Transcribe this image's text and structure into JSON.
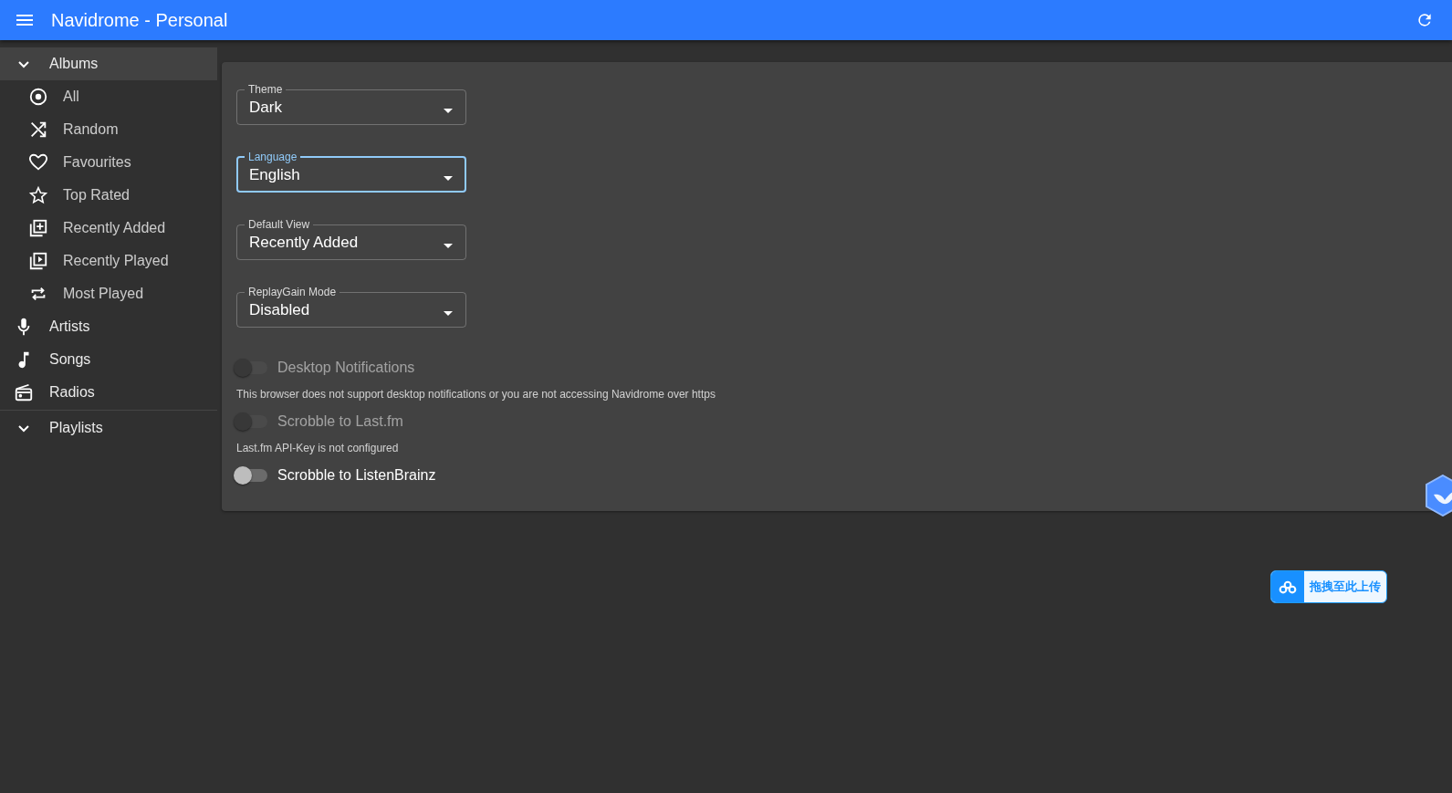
{
  "app_bar": {
    "title": "Navidrome - Personal"
  },
  "sidebar": {
    "items": [
      {
        "label": "Albums",
        "kind": "group",
        "expanded": true,
        "selected": true,
        "children": [
          {
            "label": "All",
            "selected": false
          },
          {
            "label": "Random",
            "selected": false
          },
          {
            "label": "Favourites",
            "selected": false
          },
          {
            "label": "Top Rated",
            "selected": false
          },
          {
            "label": "Recently Added",
            "selected": false
          },
          {
            "label": "Recently Played",
            "selected": false
          },
          {
            "label": "Most Played",
            "selected": false
          }
        ]
      },
      {
        "label": "Artists",
        "kind": "link",
        "selected": false
      },
      {
        "label": "Songs",
        "kind": "link",
        "selected": false
      },
      {
        "label": "Radios",
        "kind": "link",
        "selected": false
      },
      {
        "label": "Playlists",
        "kind": "group",
        "expanded": true,
        "selected": false
      }
    ]
  },
  "settings": {
    "selects": [
      {
        "label": "Theme",
        "value": "Dark",
        "focused": false
      },
      {
        "label": "Language",
        "value": "English",
        "focused": true
      },
      {
        "label": "Default View",
        "value": "Recently Added",
        "focused": false
      },
      {
        "label": "ReplayGain Mode",
        "value": "Disabled",
        "focused": false
      }
    ],
    "toggles": [
      {
        "label": "Desktop Notifications",
        "checked": false,
        "disabled": true,
        "helper": "This browser does not support desktop notifications or you are not accessing Navidrome over https"
      },
      {
        "label": "Scrobble to Last.fm",
        "checked": false,
        "disabled": true,
        "helper": "Last.fm API-Key is not configured"
      },
      {
        "label": "Scrobble to ListenBrainz",
        "checked": false,
        "disabled": false
      }
    ]
  },
  "upload_badge": {
    "label": "拖拽至此上传"
  }
}
